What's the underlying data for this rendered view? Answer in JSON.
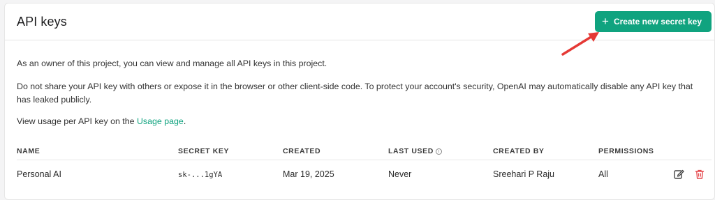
{
  "header": {
    "title": "API keys",
    "create_button_label": "Create new secret key"
  },
  "description": {
    "line1": "As an owner of this project, you can view and manage all API keys in this project.",
    "line2": "Do not share your API key with others or expose it in the browser or other client-side code. To protect your account's security, OpenAI may automatically disable any API key that has leaked publicly.",
    "line3_prefix": "View usage per API key on the ",
    "line3_link": "Usage page",
    "line3_suffix": "."
  },
  "table": {
    "columns": [
      "NAME",
      "SECRET KEY",
      "CREATED",
      "LAST USED",
      "CREATED BY",
      "PERMISSIONS"
    ],
    "rows": [
      {
        "name": "Personal AI",
        "secret_key": "sk-...1gYA",
        "created": "Mar 19, 2025",
        "last_used": "Never",
        "created_by": "Sreehari P Raju",
        "permissions": "All"
      }
    ]
  },
  "colors": {
    "accent": "#10a37f",
    "danger": "#e5484d",
    "annotation_arrow": "#e53935"
  },
  "icons": [
    "plus-icon",
    "info-icon",
    "edit-icon",
    "delete-icon",
    "annotation-arrow"
  ]
}
